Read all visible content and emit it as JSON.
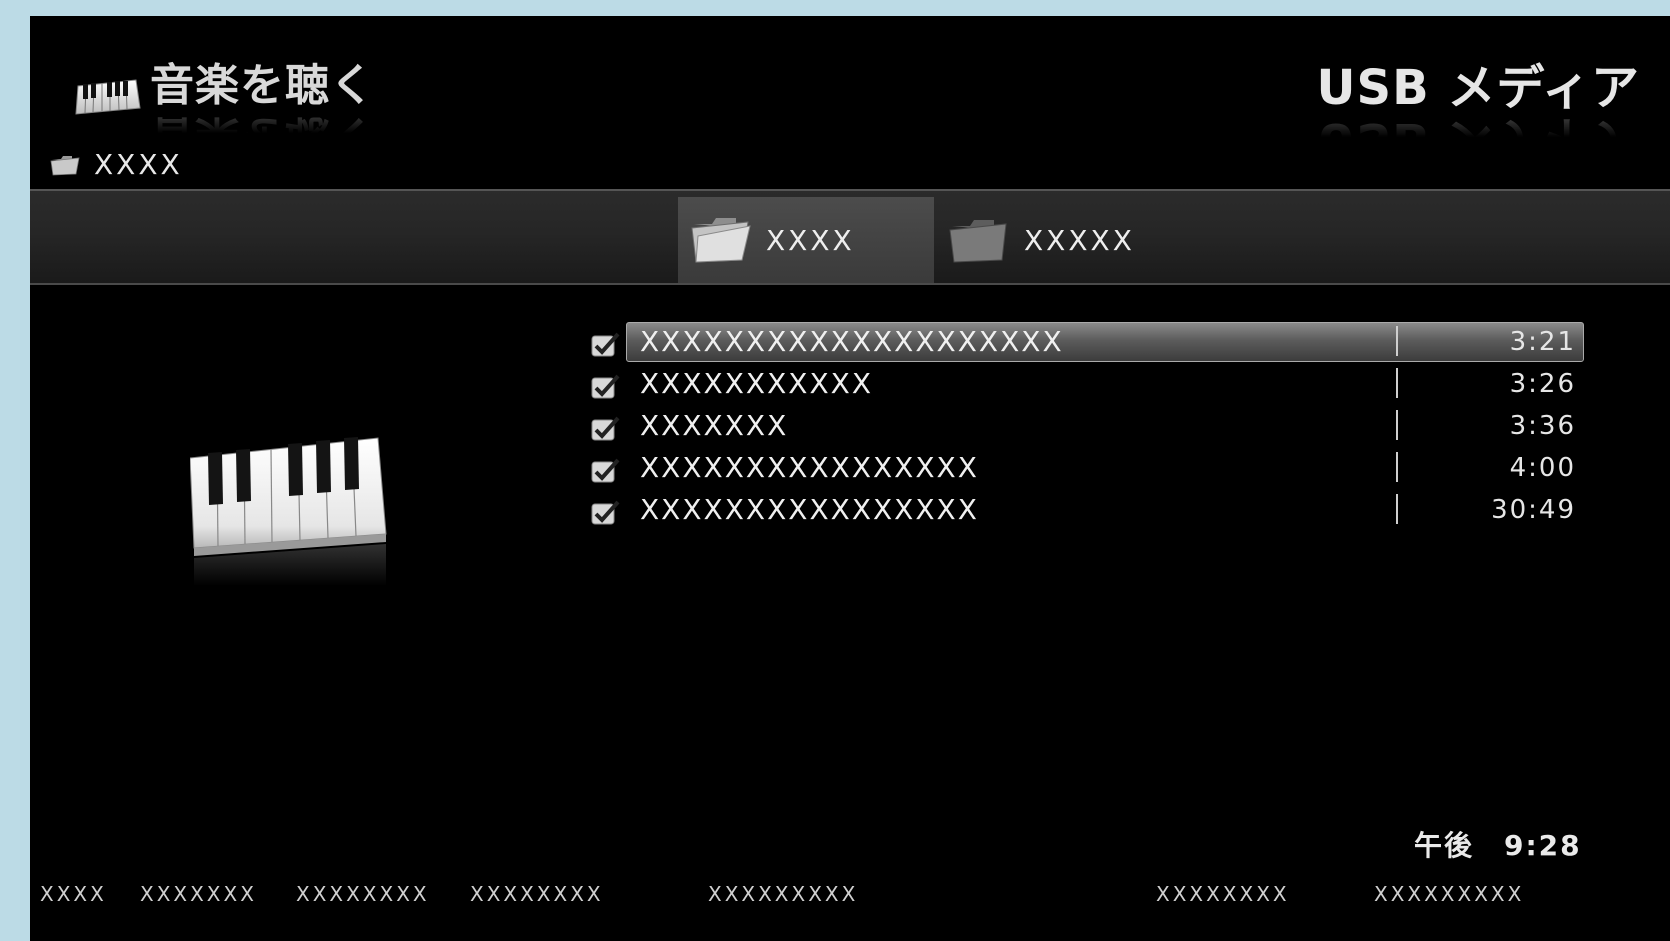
{
  "header": {
    "app_title": "音楽を聴く",
    "source": "USB メディア"
  },
  "path": {
    "current_folder": "XXXX"
  },
  "folders": [
    {
      "label": "XXXX",
      "active": true
    },
    {
      "label": "XXXXX",
      "active": false
    }
  ],
  "tracks": [
    {
      "title": "XXXXXXXXXXXXXXXXXXXX",
      "duration": "3:21",
      "checked": true,
      "selected": true
    },
    {
      "title": "XXXXXXXXXXX",
      "duration": "3:26",
      "checked": true,
      "selected": false
    },
    {
      "title": "XXXXXXX",
      "duration": "3:36",
      "checked": true,
      "selected": false
    },
    {
      "title": "XXXXXXXXXXXXXXXX",
      "duration": "4:00",
      "checked": true,
      "selected": false
    },
    {
      "title": "XXXXXXXXXXXXXXXX",
      "duration": "30:49",
      "checked": true,
      "selected": false
    }
  ],
  "clock": "午後　9:28",
  "footer": {
    "hints": [
      "XXXX",
      "XXXXXXX",
      "XXXXXXXX",
      "XXXXXXXX",
      "XXXXXXXXX",
      "XXXXXXXX",
      "XXXXXXXXX"
    ]
  },
  "icons": {
    "app": "piano-keyboard-icon",
    "path": "folder-icon",
    "checkbox": "checkmark-icon"
  },
  "colors": {
    "screen_bg": "#000000",
    "frame_bg": "#bcdbe6",
    "selection": "#6a6a6a"
  }
}
